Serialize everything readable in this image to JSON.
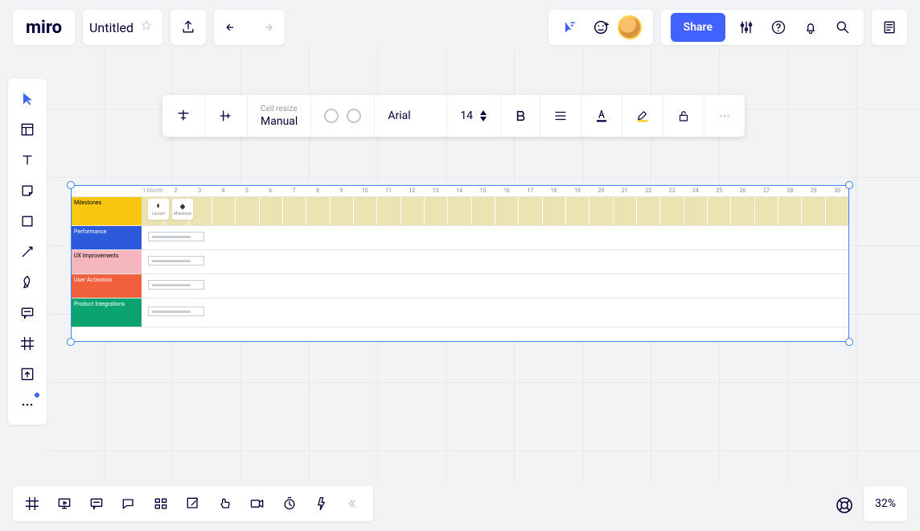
{
  "app": {
    "logo": "miro",
    "board_title": "Untitled"
  },
  "share": {
    "label": "Share"
  },
  "context_bar": {
    "cell_resize_caption": "Cell resize",
    "cell_resize_value": "Manual",
    "font": "Arial",
    "font_size": "14"
  },
  "table": {
    "header_month": "1 Month",
    "days": [
      "2",
      "3",
      "4",
      "5",
      "6",
      "7",
      "8",
      "9",
      "10",
      "11",
      "12",
      "13",
      "14",
      "15",
      "16",
      "17",
      "18",
      "19",
      "20",
      "21",
      "22",
      "23",
      "24",
      "25",
      "26",
      "27",
      "28",
      "29",
      "30"
    ],
    "rows": [
      {
        "label": "Milestones",
        "color": "yellow"
      },
      {
        "label": "Performance",
        "color": "blue"
      },
      {
        "label": "UX Improvements",
        "color": "pink"
      },
      {
        "label": "User Activation",
        "color": "orange"
      },
      {
        "label": "Product Integrations",
        "color": "green"
      }
    ],
    "milestones": [
      {
        "name": "Launch"
      },
      {
        "name": "Milestone"
      }
    ]
  },
  "zoom": {
    "value": "32%"
  }
}
